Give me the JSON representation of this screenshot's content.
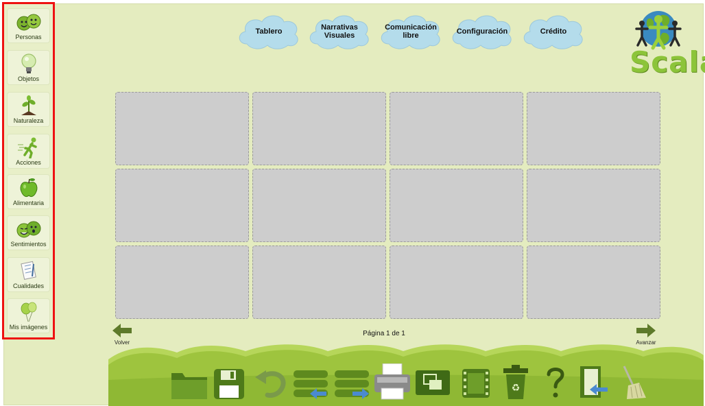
{
  "sidebar": {
    "items": [
      {
        "label": "Personas",
        "icon": "people-faces-icon"
      },
      {
        "label": "Objetos",
        "icon": "lightbulb-icon"
      },
      {
        "label": "Naturaleza",
        "icon": "plant-sprout-icon"
      },
      {
        "label": "Acciones",
        "icon": "running-figure-icon"
      },
      {
        "label": "Alimentaria",
        "icon": "apple-icon"
      },
      {
        "label": "Sentimientos",
        "icon": "emotion-faces-icon"
      },
      {
        "label": "Cualidades",
        "icon": "checklist-icon"
      },
      {
        "label": "Mis imágenes",
        "icon": "balloons-icon"
      }
    ]
  },
  "top_menu": {
    "items": [
      {
        "label": "Tablero"
      },
      {
        "label": "Narrativas\nVisuales"
      },
      {
        "label": "Comunicación\nlibre"
      },
      {
        "label": "Configuración"
      },
      {
        "label": "Crédito"
      }
    ]
  },
  "logo": {
    "text": "Scala"
  },
  "board": {
    "rows": 3,
    "cols": 4
  },
  "paging": {
    "prev_label": "Volver",
    "next_label": "Avanzar",
    "page_text": "Página 1 de 1"
  },
  "toolbar": {
    "tools": [
      "open-folder-icon",
      "save-icon",
      "undo-icon",
      "move-rows-left-icon",
      "move-rows-right-icon",
      "print-icon",
      "swap-icon",
      "film-icon",
      "recycle-bin-icon",
      "help-icon",
      "exit-icon",
      "broom-icon"
    ]
  },
  "colors": {
    "background": "#e4ecbf",
    "cloud": "#b4dceb",
    "grass": "#9ec43e",
    "cell": "#cdcdcd",
    "highlight": "#ee1111"
  }
}
